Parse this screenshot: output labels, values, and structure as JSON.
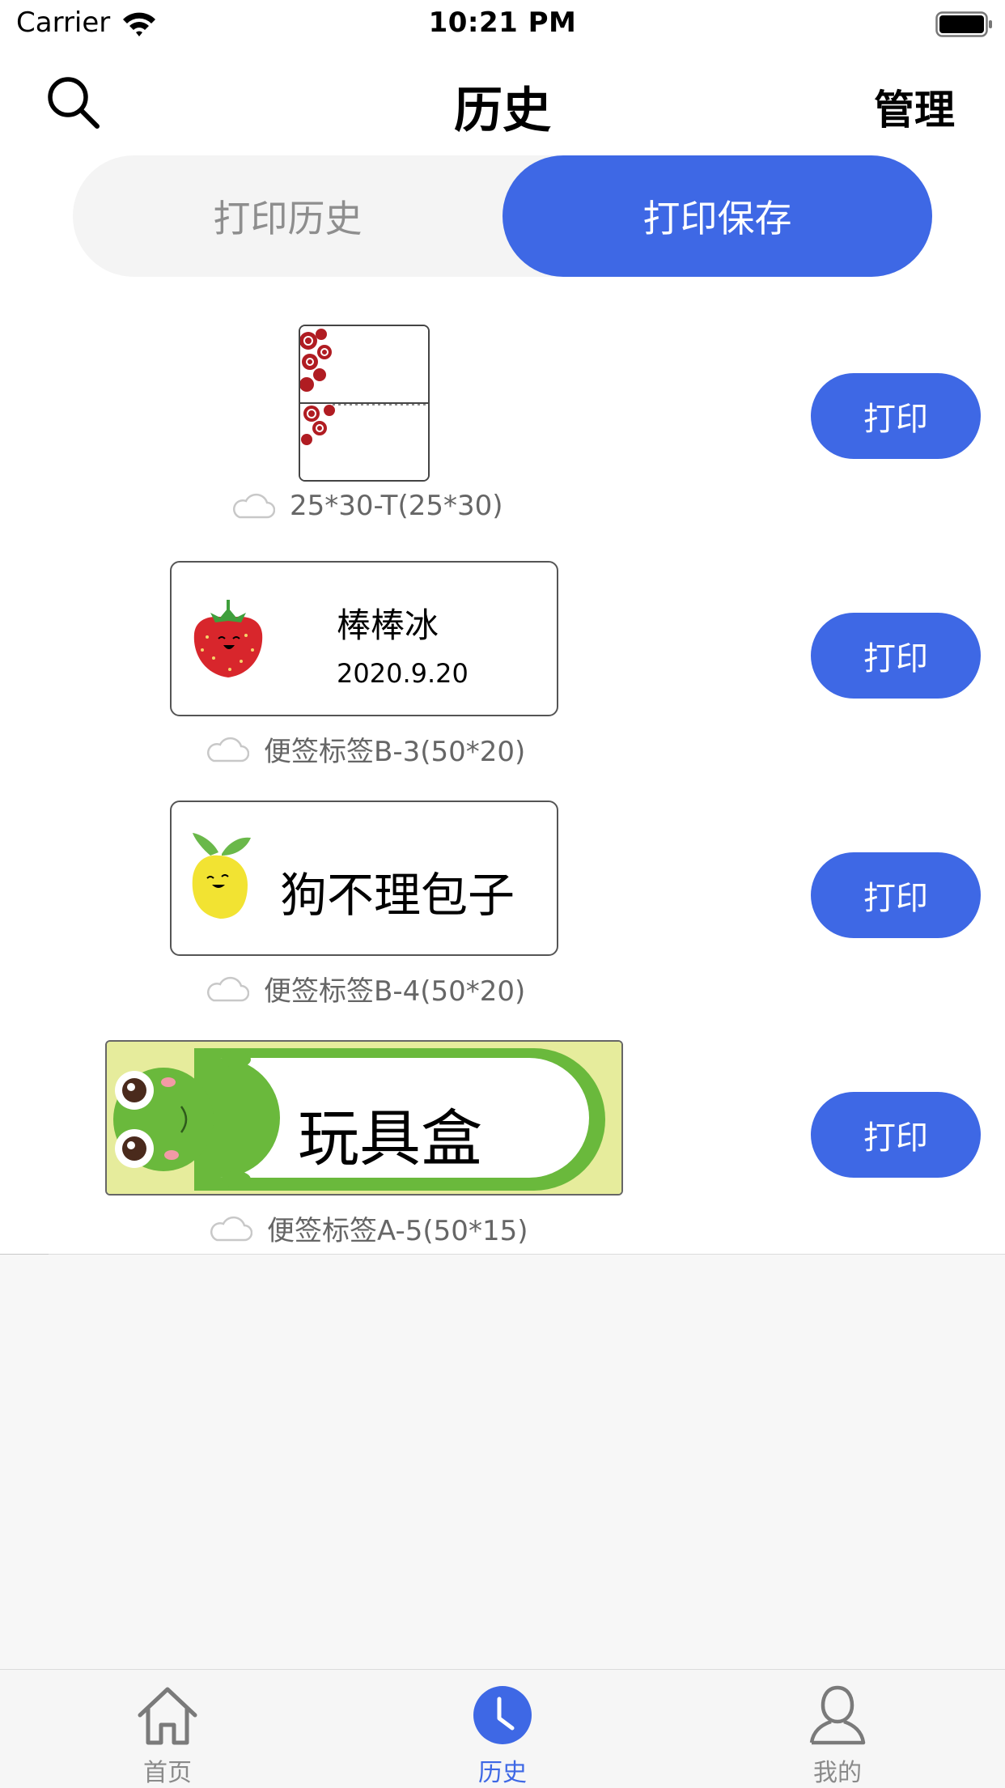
{
  "status_bar": {
    "carrier": "Carrier",
    "time": "10:21 PM"
  },
  "nav": {
    "title": "历史",
    "manage_label": "管理"
  },
  "segmented": {
    "tabs": [
      {
        "label": "打印历史",
        "selected": false
      },
      {
        "label": "打印保存",
        "selected": true
      }
    ]
  },
  "items": [
    {
      "caption": "25*30-T(25*30)",
      "print_label": "打印",
      "preview": {
        "type": "blank-template"
      }
    },
    {
      "caption": "便签标签B-3(50*20)",
      "print_label": "打印",
      "preview": {
        "type": "strawberry",
        "title": "棒棒冰",
        "date": "2020.9.20"
      }
    },
    {
      "caption": "便签标签B-4(50*20)",
      "print_label": "打印",
      "preview": {
        "type": "mango",
        "title": "狗不理包子"
      }
    },
    {
      "caption": "便签标签A-5(50*15)",
      "print_label": "打印",
      "preview": {
        "type": "frog",
        "title": "玩具盒"
      }
    }
  ],
  "tab_bar": {
    "tabs": [
      {
        "label": "首页",
        "icon": "home-icon",
        "active": false
      },
      {
        "label": "历史",
        "icon": "clock-icon",
        "active": true
      },
      {
        "label": "我的",
        "icon": "person-icon",
        "active": false
      }
    ]
  },
  "colors": {
    "accent": "#3e68e5",
    "segment_bg": "#f4f4f4",
    "caption": "#666666"
  }
}
